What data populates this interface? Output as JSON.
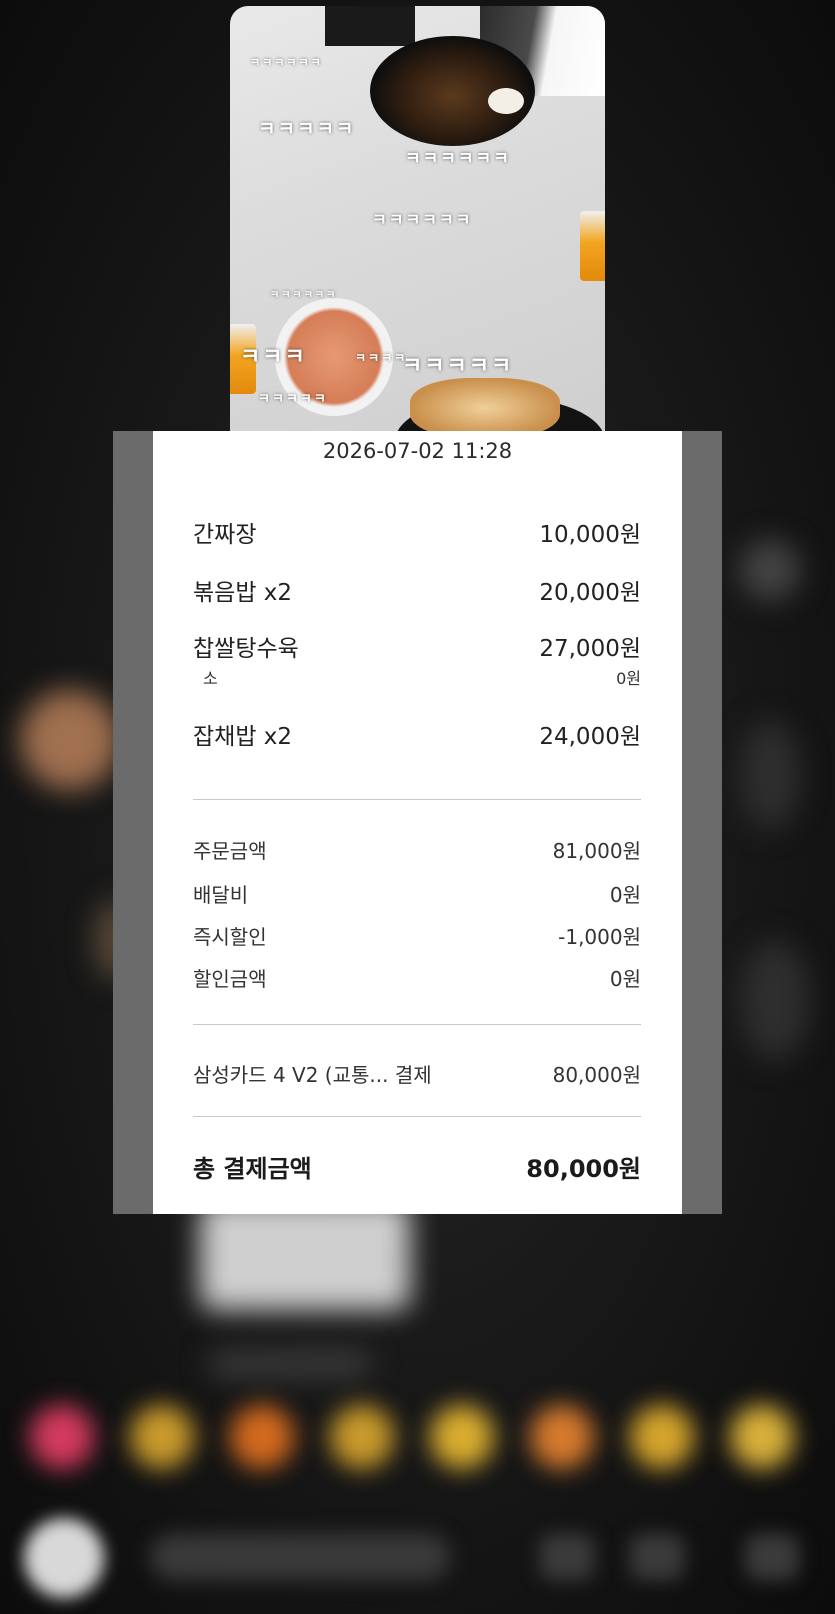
{
  "photo": {
    "overlay_text": [
      "ㅋㅋㅋㅋㅋㅋ",
      "ㅋㅋㅋㅋㅋ",
      "ㅋㅋㅋㅋㅋㅋ",
      "ㅋㅋㅋㅋㅋㅋ",
      "ㅋㅋㅋㅋㅋㅋ",
      "ㅋㅋㅋ",
      "ㅋㅋㅋㅋ",
      "ㅋㅋㅋㅋㅋ",
      "ㅋㅋㅋㅋㅋ"
    ]
  },
  "receipt": {
    "timestamp": "2026-07-02 11:28",
    "items": [
      {
        "name": "간짜장",
        "price": "10,000원"
      },
      {
        "name": "볶음밥 x2",
        "price": "20,000원"
      },
      {
        "name": "찹쌀탕수육",
        "price": "27,000원",
        "option": {
          "name": "소",
          "price": "0원"
        }
      },
      {
        "name": "잡채밥 x2",
        "price": "24,000원"
      }
    ],
    "summary": [
      {
        "label": "주문금액",
        "value": "81,000원"
      },
      {
        "label": "배달비",
        "value": "0원"
      },
      {
        "label": "즉시할인",
        "value": "-1,000원"
      },
      {
        "label": "할인금액",
        "value": "0원"
      }
    ],
    "payment": {
      "method": "삼성카드 4 V2 (교통... 결제",
      "amount": "80,000원"
    },
    "total": {
      "label": "총 결제금액",
      "amount": "80,000원"
    }
  },
  "colors": {
    "background": "#111111",
    "receipt_frame": "#6b6b6b",
    "receipt_bg": "#ffffff",
    "divider": "#c9c9c9"
  }
}
